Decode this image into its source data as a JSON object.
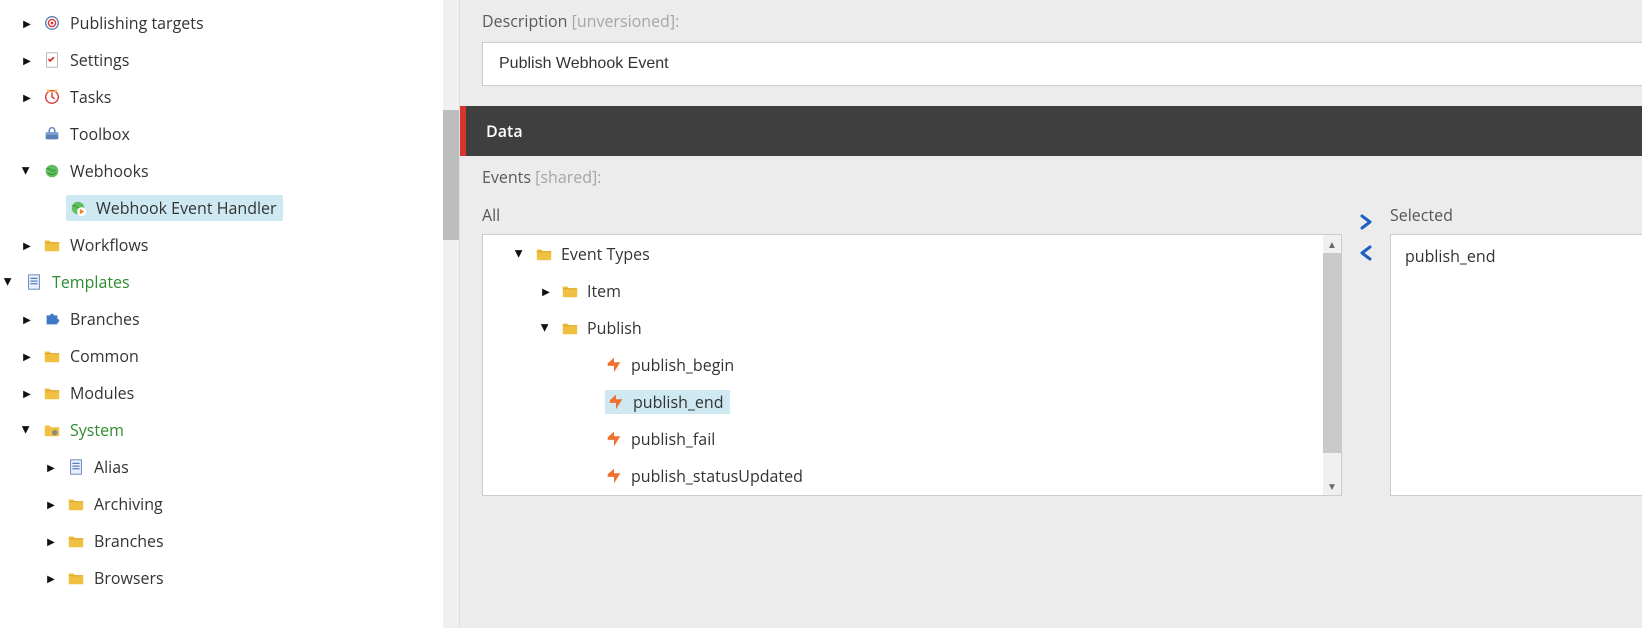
{
  "sidebar": {
    "items": [
      {
        "label": "Publishing targets",
        "icon": "target",
        "caret": "right",
        "depth": 1
      },
      {
        "label": "Settings",
        "icon": "checkdoc",
        "caret": "right",
        "depth": 1
      },
      {
        "label": "Tasks",
        "icon": "clock",
        "caret": "right",
        "depth": 1
      },
      {
        "label": "Toolbox",
        "icon": "toolbox",
        "caret": "none",
        "depth": 1
      },
      {
        "label": "Webhooks",
        "icon": "globe",
        "caret": "down",
        "depth": 1
      },
      {
        "label": "Webhook Event Handler",
        "icon": "globe-play",
        "caret": "none",
        "depth": 2,
        "selected": true
      },
      {
        "label": "Workflows",
        "icon": "folder",
        "caret": "right",
        "depth": 1
      },
      {
        "label": "Templates",
        "icon": "doc",
        "caret": "down",
        "depth": 0,
        "green": true
      },
      {
        "label": "Branches",
        "icon": "puzzle",
        "caret": "right",
        "depth": 1
      },
      {
        "label": "Common",
        "icon": "folder",
        "caret": "right",
        "depth": 1
      },
      {
        "label": "Modules",
        "icon": "folder",
        "caret": "right",
        "depth": 1
      },
      {
        "label": "System",
        "icon": "folder-gear",
        "caret": "down",
        "depth": 1,
        "green": true
      },
      {
        "label": "Alias",
        "icon": "doc",
        "caret": "right",
        "depth": 2
      },
      {
        "label": "Archiving",
        "icon": "folder",
        "caret": "right",
        "depth": 2
      },
      {
        "label": "Branches",
        "icon": "folder",
        "caret": "right",
        "depth": 2
      },
      {
        "label": "Browsers",
        "icon": "folder",
        "caret": "right",
        "depth": 2
      }
    ]
  },
  "editor": {
    "description": {
      "label_main": "Description",
      "label_flag": "[unversioned]",
      "value": "Publish Webhook Event"
    },
    "section_title": "Data",
    "events": {
      "label_main": "Events",
      "label_flag": "[shared]",
      "all_title": "All",
      "selected_title": "Selected",
      "tree": [
        {
          "label": "Event Types",
          "icon": "folder",
          "caret": "down",
          "d": 1
        },
        {
          "label": "Item",
          "icon": "folder",
          "caret": "right",
          "d": 2
        },
        {
          "label": "Publish",
          "icon": "folder",
          "caret": "down",
          "d": 2
        },
        {
          "label": "publish_begin",
          "icon": "event",
          "caret": "none",
          "d": 3
        },
        {
          "label": "publish_end",
          "icon": "event",
          "caret": "none",
          "d": 3,
          "picked": true
        },
        {
          "label": "publish_fail",
          "icon": "event",
          "caret": "none",
          "d": 3
        },
        {
          "label": "publish_statusUpdated",
          "icon": "event",
          "caret": "none",
          "d": 3
        }
      ],
      "selected_items": [
        "publish_end"
      ]
    }
  }
}
